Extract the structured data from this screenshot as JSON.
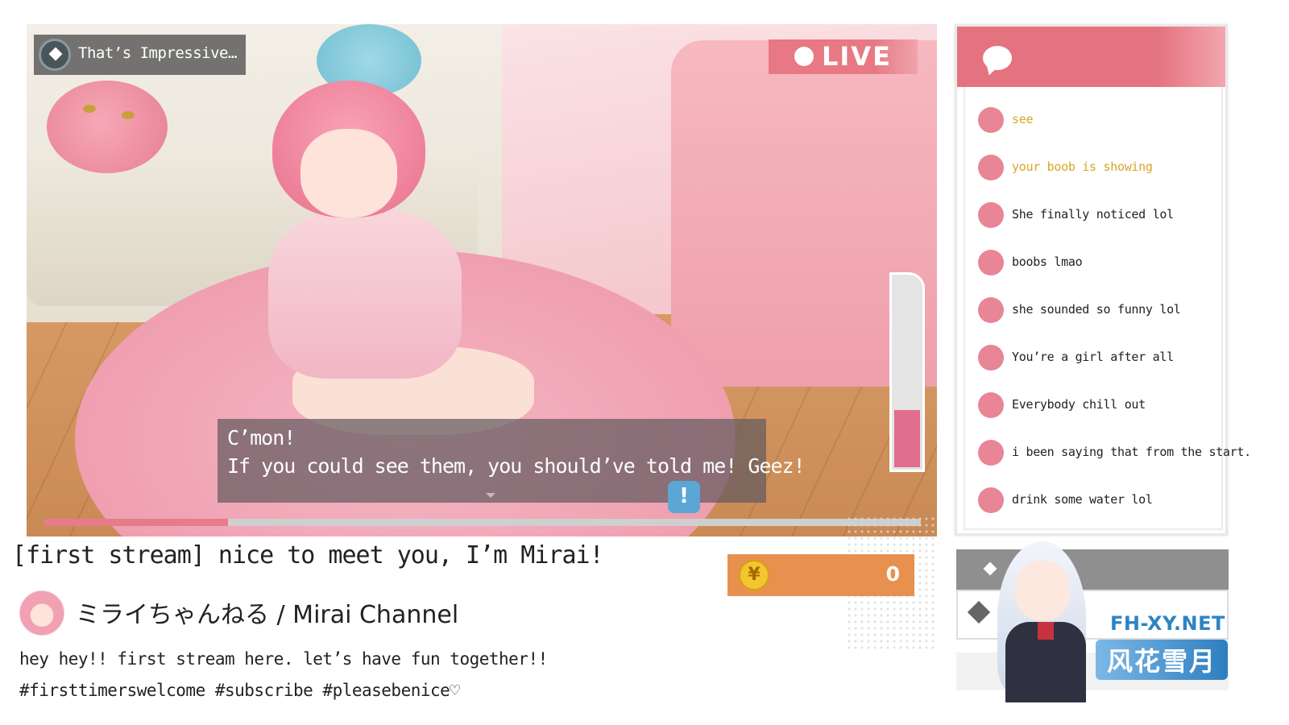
{
  "achievement": {
    "icon": "diamond-icon",
    "text": "That’s Impressive…"
  },
  "live_badge": {
    "label": "LIVE",
    "color": "#e77884"
  },
  "gauge": {
    "level": 0.3,
    "color": "#e06e8c"
  },
  "dialogue": {
    "line1": "C’mon!",
    "line2": "If you could see them, you should’ve told me! Geez!",
    "alert_icon": "!"
  },
  "progress": {
    "value": 0.21,
    "color": "#e67c8a"
  },
  "stream": {
    "title": "[first stream] nice to meet you, I’m Mirai!",
    "channel": "ミライちゃんねる / Mirai Channel",
    "description": "hey hey!! first stream here. let’s have fun together!!",
    "tags": "#firsttimerswelcome #subscribe #pleasebenice♡"
  },
  "currency": {
    "symbol": "¥",
    "value": "0"
  },
  "chat": {
    "icon": "chat-bubble-icon",
    "accent": "#e4737f",
    "messages": [
      {
        "text": "see",
        "highlight": true
      },
      {
        "text": "your boob is showing",
        "highlight": true
      },
      {
        "text": "She finally noticed lol",
        "highlight": false
      },
      {
        "text": "boobs lmao",
        "highlight": false
      },
      {
        "text": "she sounded so funny lol",
        "highlight": false
      },
      {
        "text": "You’re a girl after all",
        "highlight": false
      },
      {
        "text": "Everybody chill out",
        "highlight": false
      },
      {
        "text": "i been saying that from the start.",
        "highlight": false
      },
      {
        "text": "drink some water lol",
        "highlight": false
      }
    ],
    "highlight_color": "#d9a627"
  },
  "watermark": {
    "en": "FH-XY.NET",
    "cn": "风花雪月"
  }
}
